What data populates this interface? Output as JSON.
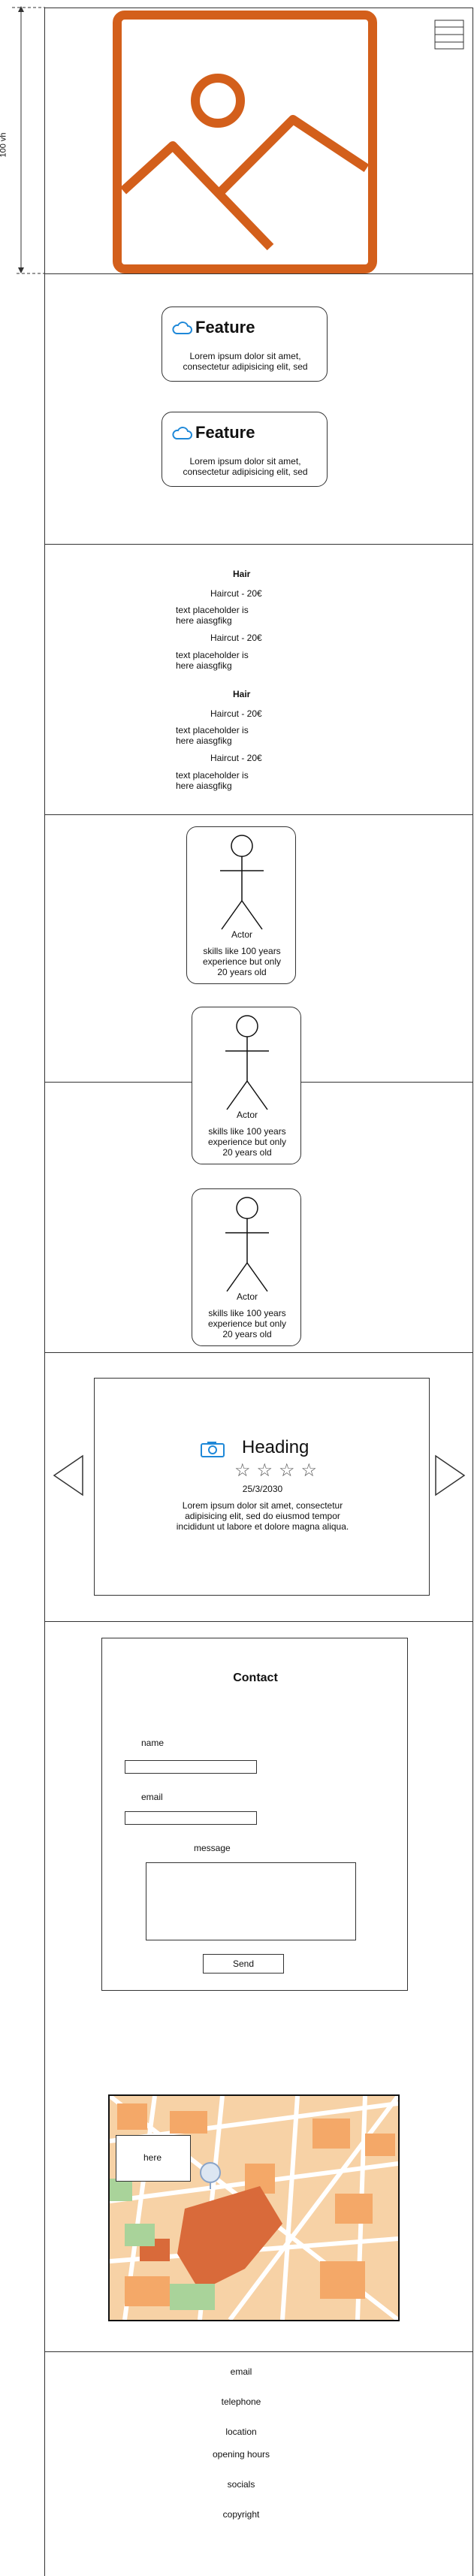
{
  "page": {
    "height_marker_label": "100 vh"
  },
  "hero": {
    "image_icon": "image-icon",
    "menu_icon": "hamburger-menu-icon",
    "accent": "#d35f1b"
  },
  "features": [
    {
      "title": "Feature",
      "text_line1": "Lorem ipsum dolor sit amet,",
      "text_line2": "consectetur adipisicing elit, sed"
    },
    {
      "title": "Feature",
      "text_line1": "Lorem ipsum dolor sit amet,",
      "text_line2": "consectetur adipisicing elit, sed"
    }
  ],
  "pricing": {
    "groups": [
      {
        "heading": "Hair",
        "items": [
          {
            "name": "Haircut - 20€",
            "desc1": "text placeholder is",
            "desc2": "here aiasgfikg"
          },
          {
            "name": "Haircut - 20€",
            "desc1": "text placeholder is",
            "desc2": "here aiasgfikg"
          }
        ]
      },
      {
        "heading": "Hair",
        "items": [
          {
            "name": "Haircut - 20€",
            "desc1": "text placeholder is",
            "desc2": "here aiasgfikg"
          },
          {
            "name": "Haircut - 20€",
            "desc1": "text placeholder is",
            "desc2": "here aiasgfikg"
          }
        ]
      }
    ]
  },
  "team": [
    {
      "label": "Actor",
      "line1": "skills like 100 years",
      "line2": "experience but only",
      "line3": "20 years old"
    },
    {
      "label": "Actor",
      "line1": "skills like 100 years",
      "line2": "experience but only",
      "line3": "20 years old"
    },
    {
      "label": "Actor",
      "line1": "skills like 100 years",
      "line2": "experience but only",
      "line3": "20 years old"
    }
  ],
  "review": {
    "heading": "Heading",
    "rating": 0,
    "date": "25/3/2030",
    "line1": "Lorem ipsum dolor sit amet, consectetur",
    "line2": "adipisicing elit, sed do eiusmod tempor",
    "line3": "incididunt ut labore et dolore magna aliqua.",
    "camera_icon_color": "#1e88d8"
  },
  "contact": {
    "title": "Contact",
    "name_label": "name",
    "email_label": "email",
    "message_label": "message",
    "send_label": "Send"
  },
  "map": {
    "marker_label": "here"
  },
  "footer": {
    "items": [
      "email",
      "telephone",
      "location",
      "opening hours",
      "socials",
      "copyright"
    ]
  }
}
